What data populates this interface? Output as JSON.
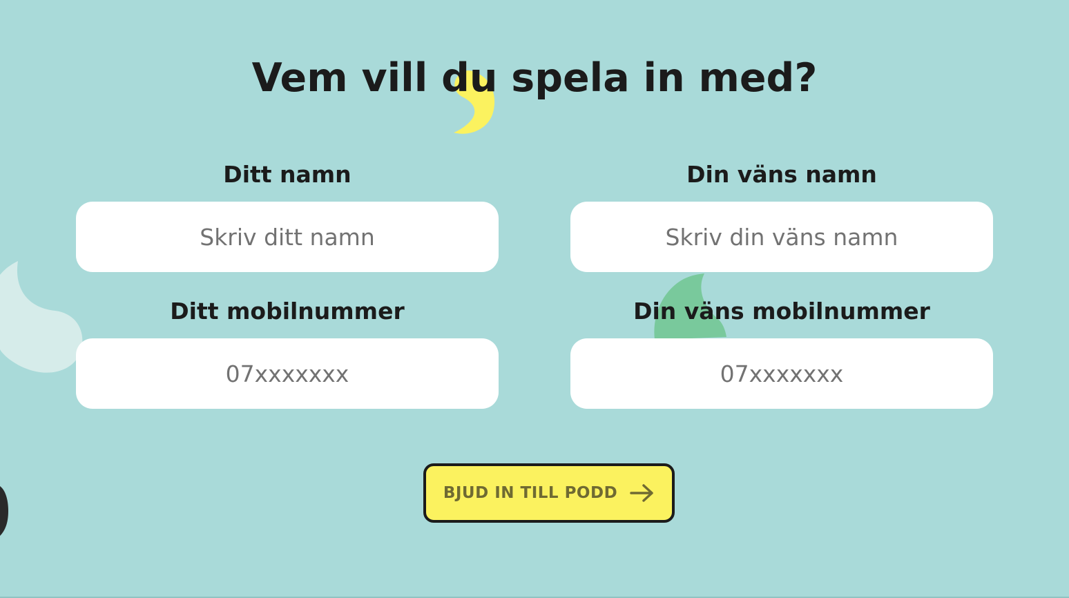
{
  "title": "Vem vill du spela in med?",
  "form": {
    "your_name": {
      "label": "Ditt namn",
      "value": "",
      "placeholder": "Skriv ditt namn"
    },
    "friend_name": {
      "label": "Din väns namn",
      "value": "",
      "placeholder": "Skriv din väns namn"
    },
    "your_phone": {
      "label": "Ditt mobilnummer",
      "value": "",
      "placeholder": "07xxxxxxx"
    },
    "friend_phone": {
      "label": "Din väns mobilnummer",
      "value": "",
      "placeholder": "07xxxxxxx"
    }
  },
  "cta": {
    "label": "BJUD IN TILL PODD",
    "icon": "arrow-right-icon"
  },
  "colors": {
    "background": "#a9dad9",
    "accent_yellow": "#fbf25f",
    "accent_green": "#79c99c",
    "text_dark": "#1b1b1b",
    "placeholder": "#727272"
  }
}
